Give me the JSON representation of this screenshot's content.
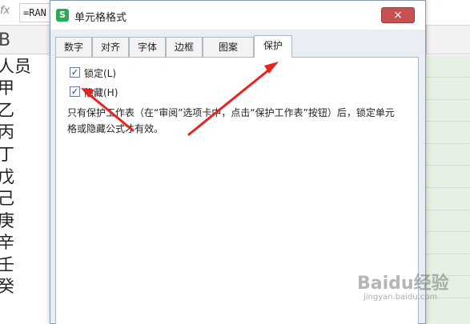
{
  "spreadsheet": {
    "fx_label": "fx",
    "formula_text": "=RAN",
    "column_letter": "B",
    "cells": [
      "人员",
      "甲",
      "乙",
      "丙",
      "丁",
      "戊",
      "己",
      "庚",
      "辛",
      "壬",
      "癸"
    ],
    "highlight_color": "#e5f1e3"
  },
  "dialog": {
    "app_icon": "S",
    "title": "单元格格式",
    "close_icon": "×",
    "tabs": [
      "数字",
      "对齐",
      "字体",
      "边框",
      "图案",
      "保护"
    ],
    "active_tab": "保护",
    "checkboxes": [
      {
        "label": "锁定(L)",
        "checked": true
      },
      {
        "label": "隐藏(H)",
        "checked": true
      }
    ],
    "description": "只有保护工作表（在“审阅”选项卡中，点击“保护工作表”按钮）后，锁定单元格或隐藏公式才有效。"
  },
  "annotation": {
    "arrow_color": "#e8231f"
  },
  "watermark": {
    "logo": "Baidu经验",
    "url": "jingyan.baidu.com"
  }
}
